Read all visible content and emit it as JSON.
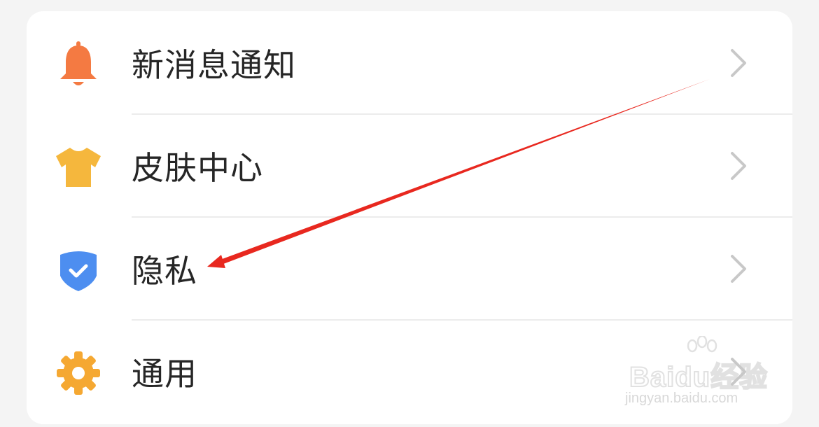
{
  "settings": {
    "items": [
      {
        "label": "新消息通知",
        "icon": "bell-icon",
        "icon_color": "#f47a42"
      },
      {
        "label": "皮肤中心",
        "icon": "tshirt-icon",
        "icon_color": "#f5b73d"
      },
      {
        "label": "隐私",
        "icon": "shield-check-icon",
        "icon_color": "#4d8ef0"
      },
      {
        "label": "通用",
        "icon": "gear-icon",
        "icon_color": "#f5a832"
      }
    ],
    "chevron_color": "#c8c8c8"
  },
  "annotation": {
    "arrow_color": "#e8281f"
  },
  "watermark": {
    "main": "Baidu经验",
    "sub": "jingyan.baidu.com"
  }
}
